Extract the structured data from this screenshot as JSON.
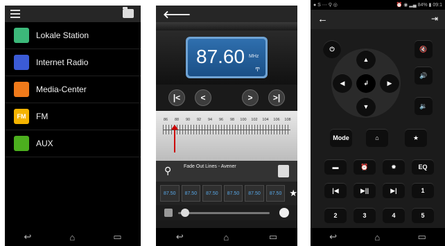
{
  "screen1": {
    "menu": [
      {
        "label": "Lokale Station",
        "icon": "location-pin-icon",
        "icon_text": "",
        "color": "#3cb97a"
      },
      {
        "label": "Internet Radio",
        "icon": "radio-icon",
        "icon_text": "",
        "color": "#3b5bd6"
      },
      {
        "label": "Media-Center",
        "icon": "media-disc-icon",
        "icon_text": "",
        "color": "#f07a1a"
      },
      {
        "label": "FM",
        "icon": "fm-icon",
        "icon_text": "FM",
        "color": "#f5b400"
      },
      {
        "label": "AUX",
        "icon": "aux-icon",
        "icon_text": "",
        "color": "#4caf1e"
      }
    ]
  },
  "screen2": {
    "frequency": "87.60",
    "unit": "MHz",
    "scale_ticks": [
      "86",
      "88",
      "90",
      "92",
      "94",
      "96",
      "98",
      "100",
      "102",
      "104",
      "106",
      "108"
    ],
    "song": "Fade Out Lines - Avener",
    "presets": [
      "87.50",
      "87.50",
      "87.50",
      "87.50",
      "87.50",
      "87.50"
    ]
  },
  "screen3": {
    "status_time": "09:1",
    "status_battery": "84%",
    "mode_label": "Mode",
    "eq_label": "EQ",
    "numbers": [
      "1",
      "2",
      "3",
      "4",
      "5"
    ]
  }
}
